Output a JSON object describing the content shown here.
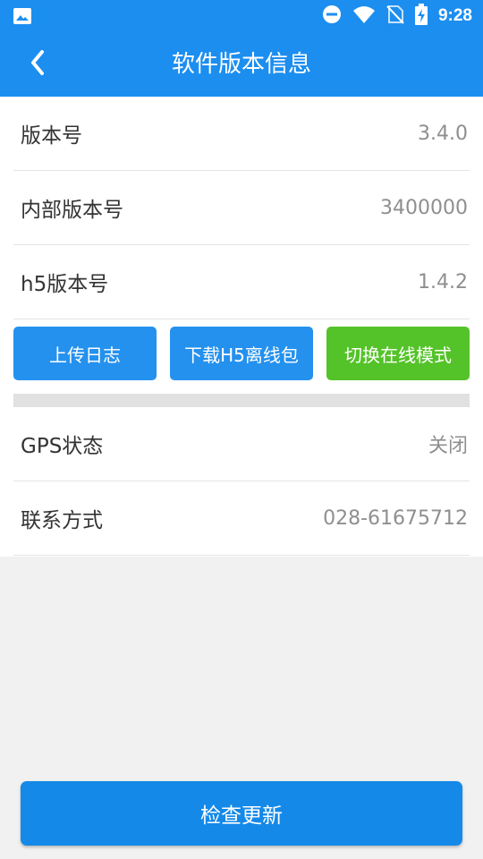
{
  "status_bar": {
    "time": "9:28",
    "icons": [
      "gallery-icon",
      "do-not-disturb-icon",
      "wifi-icon",
      "no-sim-icon",
      "battery-charging-icon"
    ]
  },
  "app_bar": {
    "back_icon": "chevron-left-icon",
    "title": "软件版本信息"
  },
  "info_rows": [
    {
      "label": "版本号",
      "value": "3.4.0"
    },
    {
      "label": "内部版本号",
      "value": "3400000"
    },
    {
      "label": "h5版本号",
      "value": "1.4.2"
    }
  ],
  "actions": [
    {
      "label": "上传日志",
      "color": "#2491ee"
    },
    {
      "label": "下载H5离线包",
      "color": "#2491ee"
    },
    {
      "label": "切换在线模式",
      "color": "#54c329"
    }
  ],
  "extra_rows": [
    {
      "label": "GPS状态",
      "value": "关闭"
    },
    {
      "label": "联系方式",
      "value": "028-61675712"
    }
  ],
  "check_update_label": "检查更新",
  "colors": {
    "primary": "#1c8ef0",
    "green": "#54c329",
    "background": "#f1f1f1"
  }
}
